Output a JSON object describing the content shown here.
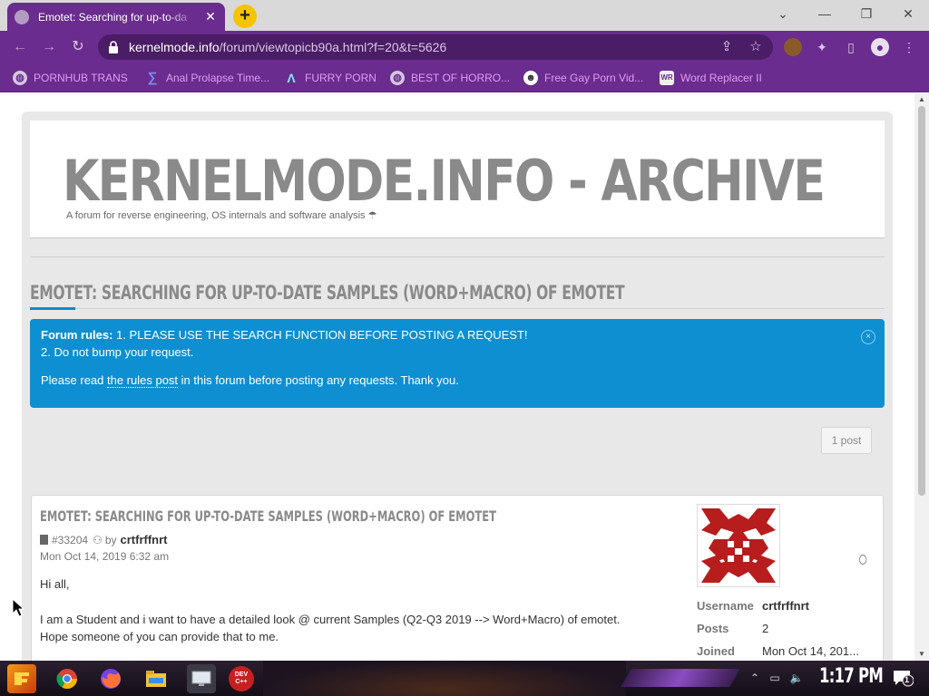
{
  "browser": {
    "tab_title": "Emotet: Searching for up-to-da",
    "tab_close": "✕",
    "new_tab": "+",
    "window_controls": {
      "dropdown": "⌄",
      "minimize": "—",
      "restore": "❐",
      "close": "✕"
    },
    "url_host": "kernelmode.info",
    "url_path": "/forum/viewtopicb90a.html?f=20&t=5626",
    "bookmarks": [
      {
        "label": "PORNHUB TRANS",
        "icon": "globe-icon"
      },
      {
        "label": "Anal Prolapse Time...",
        "icon": "bracket-icon"
      },
      {
        "label": "FURRY PORN",
        "icon": "lambda-icon"
      },
      {
        "label": "BEST OF HORRO...",
        "icon": "globe-icon"
      },
      {
        "label": "Free Gay Porn Vid...",
        "icon": "mascot-icon"
      },
      {
        "label": "Word Replacer II",
        "icon": "wr-icon"
      }
    ]
  },
  "site": {
    "title": "KERNELMODE.INFO - ARCHIVE",
    "description": "A forum for reverse engineering, OS internals and software analysis ☂"
  },
  "topic": {
    "title": "EMOTET: SEARCHING FOR UP-TO-DATE SAMPLES (WORD+MACRO) OF EMOTET",
    "rules_label": "Forum rules:",
    "rules_line1": " 1. PLEASE USE THE SEARCH FUNCTION BEFORE POSTING A REQUEST!",
    "rules_line2": "2. Do not bump your request.",
    "rules_line3_pre": "Please read ",
    "rules_link": "the rules post",
    "rules_line3_post": " in this forum before posting any requests. Thank you.",
    "post_count": "1 post"
  },
  "post": {
    "title": "EMOTET: SEARCHING FOR UP-TO-DATE SAMPLES (WORD+MACRO) OF EMOTET",
    "id": "#33204",
    "by": "by",
    "author": "crtfrffnrt",
    "date": "Mon Oct 14, 2019 6:32 am",
    "body": [
      "Hi all,",
      "I am a Student and i want to have a detailed look @ current Samples (Q2-Q3 2019 --> Word+Macro) of emotet.",
      "Hope someone of you can provide that to me."
    ],
    "profile": [
      {
        "key": "Username",
        "value": "crtfrffnrt"
      },
      {
        "key": "Posts",
        "value": "2"
      },
      {
        "key": "Joined",
        "value": "Mon Oct 14, 201..."
      }
    ]
  },
  "taskbar": {
    "clock": "1:17 PM",
    "notification_count": "1",
    "apps": [
      "start",
      "chrome",
      "firefox",
      "file-explorer",
      "remote-desktop",
      "dev-cpp"
    ],
    "dev_label": "DEV C++"
  }
}
